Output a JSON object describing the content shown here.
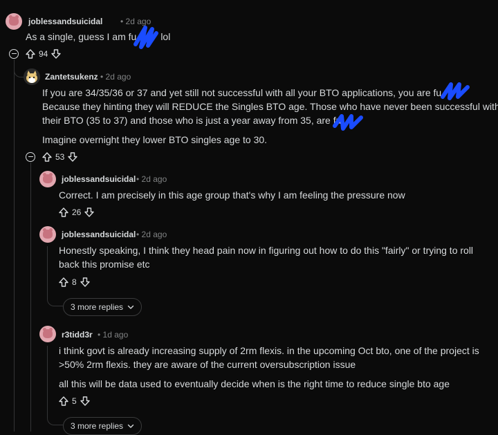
{
  "comments": {
    "c1": {
      "author": "joblessandsuicidal",
      "time": "2d ago",
      "text": "As a single, guess I am fu",
      "text_after": "lol",
      "votes": "94"
    },
    "c2": {
      "author": "Zantetsukenz",
      "time": "2d ago",
      "line1": "If you are 34/35/36 or 37 and yet still not successful with all your BTO applications, you are fu",
      "line2": "Because they hinting they will REDUCE the Singles BTO age. Those who have never been successful with",
      "line3": "their BTO (35 to 37) and those who is just a year away from 35, are fu",
      "line4": "Imagine overnight they lower BTO singles age to 30.",
      "votes": "53"
    },
    "c3": {
      "author": "joblessandsuicidal",
      "time": "2d ago",
      "text": "Correct. I am precisely in this age group that's why I am feeling the pressure now",
      "votes": "26"
    },
    "c4": {
      "author": "joblessandsuicidal",
      "time": "2d ago",
      "line1": "Honestly speaking, I think they head pain now in figuring out how to do this \"fairly\" or trying to roll",
      "line2": "back this promise etc",
      "votes": "8",
      "more": "3 more replies"
    },
    "c5": {
      "author": "r3tidd3r",
      "time": "1d ago",
      "line1": "i think govt is already increasing supply of 2rm flexis. in the upcoming Oct bto, one of the project is",
      "line2": ">50% 2rm flexis. they are aware of the current oversubscription issue",
      "line3": "all this will be data used to eventually decide when is the right time to reduce single bto age",
      "votes": "5",
      "more": "3 more replies"
    }
  },
  "separator": "•",
  "icons": {
    "upvote": "arrow-up-icon",
    "downvote": "arrow-down-icon",
    "collapse": "minus-circle-icon",
    "chevron": "chevron-down-icon"
  },
  "colors": {
    "background": "#0b0b0b",
    "text": "#d7dadc",
    "muted": "#818384",
    "redaction": "#1a4cff",
    "avatar": "#e2a7b0"
  }
}
